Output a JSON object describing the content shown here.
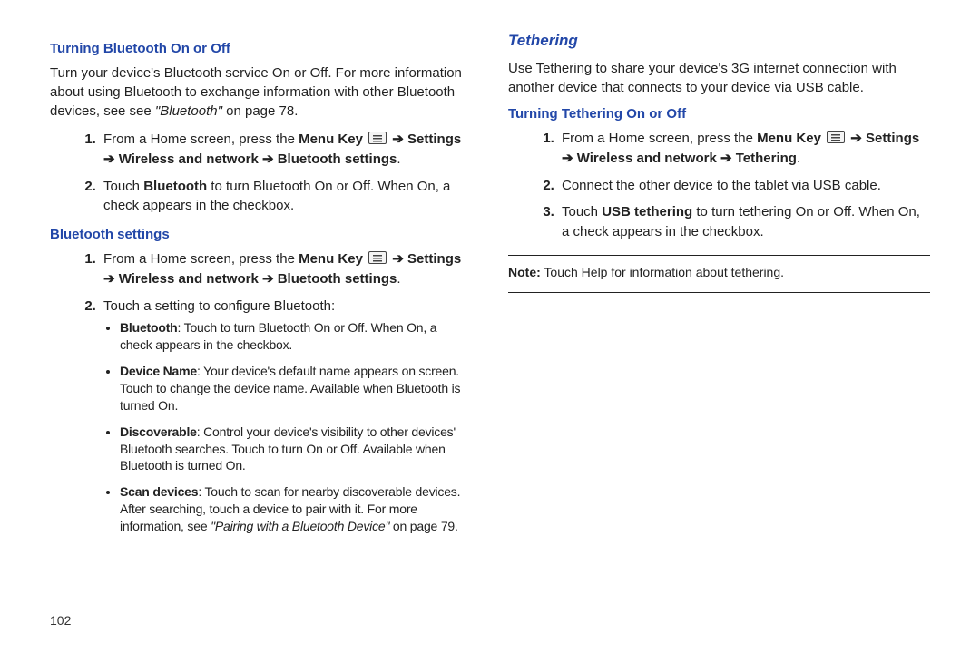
{
  "left": {
    "h1": "Turning Bluetooth On or Off",
    "intro_a": "Turn your device's Bluetooth service On or Off. For more information about using Bluetooth to exchange information with other Bluetooth devices, see see ",
    "intro_ref": "\"Bluetooth\"",
    "intro_b": " on page 78.",
    "step1_a": "From a Home screen, press the ",
    "menu_label": "Menu Key",
    "arrow": "➔",
    "settings": "Settings",
    "path1": "➔ Wireless and network ➔ Bluetooth settings",
    "step2_a": "Touch ",
    "bt_bold": "Bluetooth",
    "step2_b": " to turn Bluetooth On or Off. When On, a check appears in the checkbox.",
    "h2": "Bluetooth settings",
    "bs_step2": "Touch a setting to configure Bluetooth:",
    "bul": {
      "b1t": "Bluetooth",
      "b1": ": Touch to turn Bluetooth On or Off. When On, a check appears in the checkbox.",
      "b2t": "Device Name",
      "b2": ": Your device's default name appears on screen. Touch to change the device name. Available when Bluetooth is turned On.",
      "b3t": "Discoverable",
      "b3": ": Control your device's visibility to other devices' Bluetooth searches. Touch to turn On or Off. Available when Bluetooth is turned On.",
      "b4t": "Scan devices",
      "b4a": ": Touch to scan for nearby discoverable devices. After searching, touch a device to pair with it.  For more information, see ",
      "b4ref": "\"Pairing with a Bluetooth Device\"",
      "b4b": " on page 79."
    }
  },
  "right": {
    "h1": "Tethering",
    "intro": "Use Tethering to share your device's 3G internet connection with another device that connects to your device via USB cable.",
    "h2": "Turning Tethering On or Off",
    "path": "➔ Wireless and network ➔ Tethering",
    "step2": "Connect the other device to the tablet via USB cable.",
    "step3a": "Touch ",
    "usb_bold": "USB tethering",
    "step3b": " to turn tethering On or Off. When On, a check appears in the checkbox.",
    "note_label": "Note:",
    "note": " Touch Help for information about tethering."
  },
  "page_number": "102"
}
